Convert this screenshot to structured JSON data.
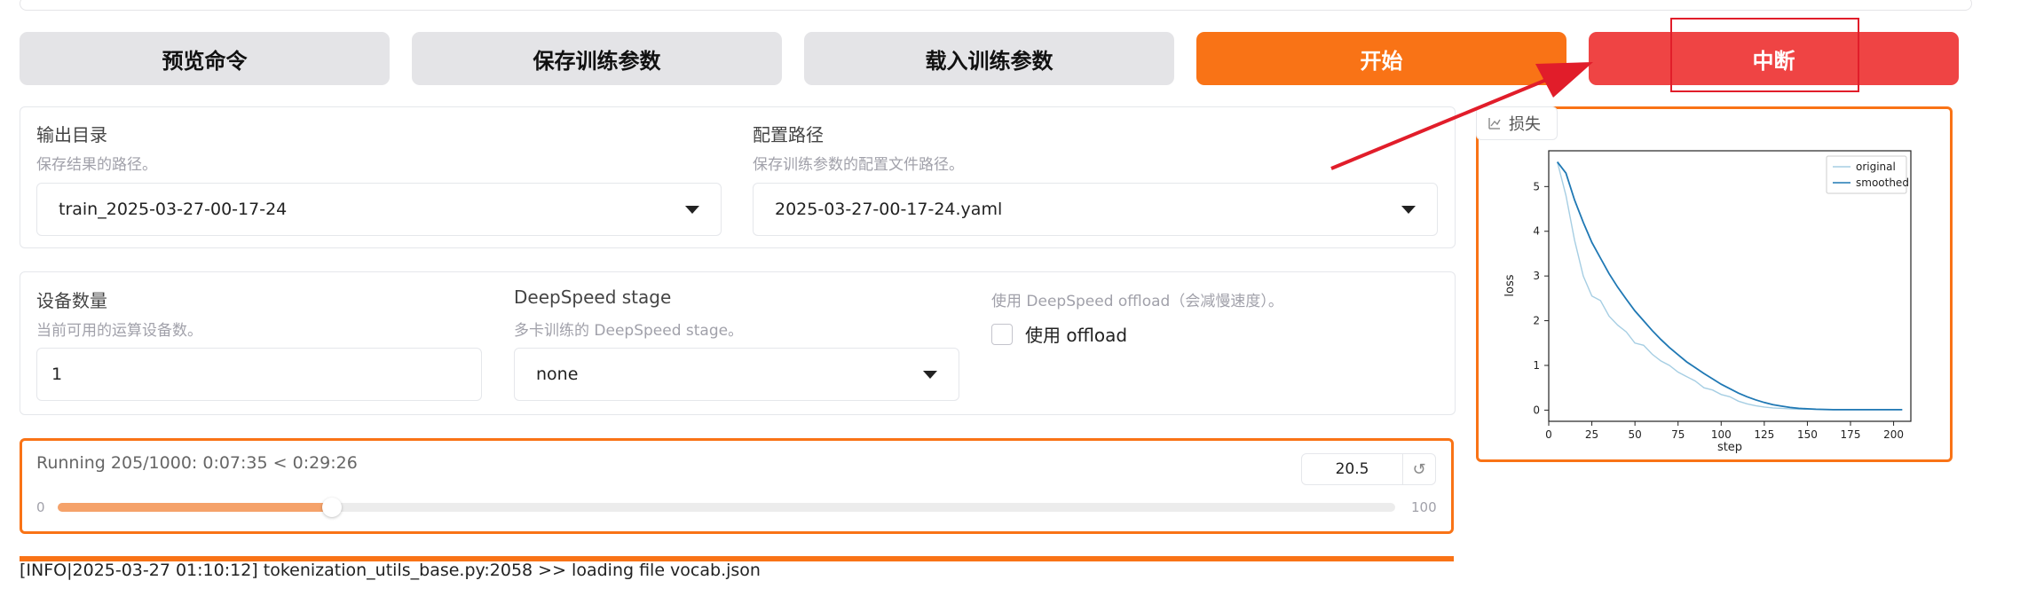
{
  "toolbar": {
    "preview_label": "预览命令",
    "save_label": "保存训练参数",
    "load_label": "载入训练参数",
    "start_label": "开始",
    "abort_label": "中断"
  },
  "output_dir": {
    "label": "输出目录",
    "info": "保存结果的路径。",
    "value": "train_2025-03-27-00-17-24"
  },
  "config_path": {
    "label": "配置路径",
    "info": "保存训练参数的配置文件路径。",
    "value": "2025-03-27-00-17-24.yaml"
  },
  "device_count": {
    "label": "设备数量",
    "info": "当前可用的运算设备数。",
    "value": "1"
  },
  "ds_stage": {
    "label": "DeepSpeed stage",
    "info": "多卡训练的 DeepSpeed stage。",
    "value": "none"
  },
  "ds_offload": {
    "info": "使用 DeepSpeed offload（会减慢速度）。",
    "checkbox_label": "使用 offload"
  },
  "progress": {
    "status": "Running 205/1000: 0:07:35 < 0:29:26",
    "min": "0",
    "max": "100",
    "value": "20.5",
    "fraction": 0.205,
    "reset_icon": "↺"
  },
  "log": {
    "line": "[INFO|2025-03-27 01:10:12] tokenization_utils_base.py:2058 >> loading file vocab.json"
  },
  "loss_panel": {
    "label": "损失",
    "icon": "chart-icon"
  },
  "colors": {
    "accent": "#f97316",
    "abort": "#ef4444",
    "annotation": "#e11d2a",
    "original": "#a6cee3",
    "smoothed": "#1f78b4"
  },
  "chart_data": {
    "type": "line",
    "xlabel": "step",
    "ylabel": "loss",
    "xlim": [
      0,
      210
    ],
    "ylim": [
      -0.25,
      5.8
    ],
    "xticks": [
      "0",
      "25",
      "50",
      "75",
      "100",
      "125",
      "150",
      "175",
      "200"
    ],
    "xtick_values": [
      0,
      25,
      50,
      75,
      100,
      125,
      150,
      175,
      200
    ],
    "yticks": [
      "0",
      "1",
      "2",
      "3",
      "4",
      "5"
    ],
    "ytick_values": [
      0,
      1,
      2,
      3,
      4,
      5
    ],
    "legend_position": "top-right",
    "series": [
      {
        "name": "original",
        "x": [
          5,
          10,
          15,
          20,
          25,
          30,
          35,
          40,
          45,
          50,
          55,
          60,
          65,
          70,
          75,
          80,
          85,
          90,
          95,
          100,
          105,
          110,
          115,
          120,
          125,
          130,
          135,
          140,
          145,
          150,
          155,
          160,
          165,
          170,
          175,
          180,
          185,
          190,
          195,
          200,
          205
        ],
        "y": [
          5.55,
          4.8,
          3.8,
          3.0,
          2.55,
          2.45,
          2.1,
          1.9,
          1.75,
          1.5,
          1.45,
          1.25,
          1.1,
          1.0,
          0.85,
          0.75,
          0.65,
          0.5,
          0.45,
          0.35,
          0.3,
          0.2,
          0.14,
          0.1,
          0.07,
          0.05,
          0.04,
          0.03,
          0.02,
          0.02,
          0.015,
          0.01,
          0.01,
          0.01,
          0.01,
          0.01,
          0.01,
          0.01,
          0.01,
          0.01,
          0.01
        ]
      },
      {
        "name": "smoothed",
        "x": [
          5,
          10,
          15,
          20,
          25,
          30,
          35,
          40,
          45,
          50,
          55,
          60,
          65,
          70,
          75,
          80,
          85,
          90,
          95,
          100,
          105,
          110,
          115,
          120,
          125,
          130,
          135,
          140,
          145,
          150,
          155,
          160,
          165,
          170,
          175,
          180,
          185,
          190,
          195,
          200,
          205
        ],
        "y": [
          5.55,
          5.3,
          4.7,
          4.2,
          3.75,
          3.4,
          3.05,
          2.75,
          2.48,
          2.22,
          2.0,
          1.78,
          1.58,
          1.4,
          1.24,
          1.08,
          0.95,
          0.82,
          0.7,
          0.58,
          0.48,
          0.38,
          0.3,
          0.23,
          0.17,
          0.12,
          0.09,
          0.06,
          0.04,
          0.03,
          0.02,
          0.015,
          0.01,
          0.01,
          0.01,
          0.01,
          0.01,
          0.01,
          0.01,
          0.01,
          0.01
        ]
      }
    ]
  }
}
